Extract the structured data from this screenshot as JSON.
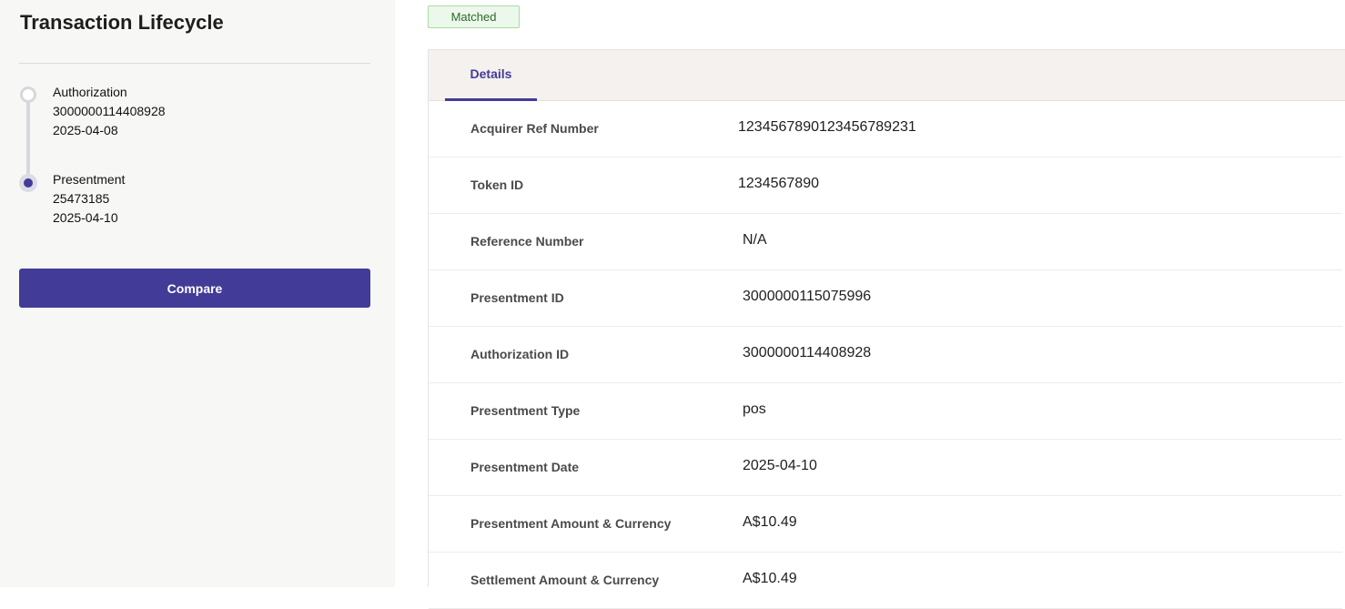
{
  "sidebar": {
    "title": "Transaction Lifecycle",
    "events": [
      {
        "title": "Authorization",
        "id": "3000000114408928",
        "date": "2025-04-08",
        "state": "open"
      },
      {
        "title": "Presentment",
        "id": "25473185",
        "date": "2025-04-10",
        "state": "active"
      }
    ],
    "compare_label": "Compare"
  },
  "status": {
    "label": "Matched",
    "color": "#2a6a2a"
  },
  "tabs": [
    {
      "label": "Details",
      "active": true
    }
  ],
  "details": [
    {
      "label": "Acquirer Ref Number",
      "value": "12345678901234567892З1"
    },
    {
      "label": "Token ID",
      "value": "1234567890"
    },
    {
      "label": "Reference Number",
      "value": "N/A"
    },
    {
      "label": "Presentment ID",
      "value": "3000000115075996"
    },
    {
      "label": "Authorization ID",
      "value": "3000000114408928"
    },
    {
      "label": "Presentment Type",
      "value": "pos"
    },
    {
      "label": "Presentment Date",
      "value": "2025-04-10"
    },
    {
      "label": "Presentment Amount & Currency",
      "value": "A$10.49"
    },
    {
      "label": "Settlement Amount & Currency",
      "value": "A$10.49"
    }
  ],
  "colors": {
    "accent": "#433b98",
    "badge_bg": "#edf8ec",
    "badge_border": "#a6dba2"
  }
}
